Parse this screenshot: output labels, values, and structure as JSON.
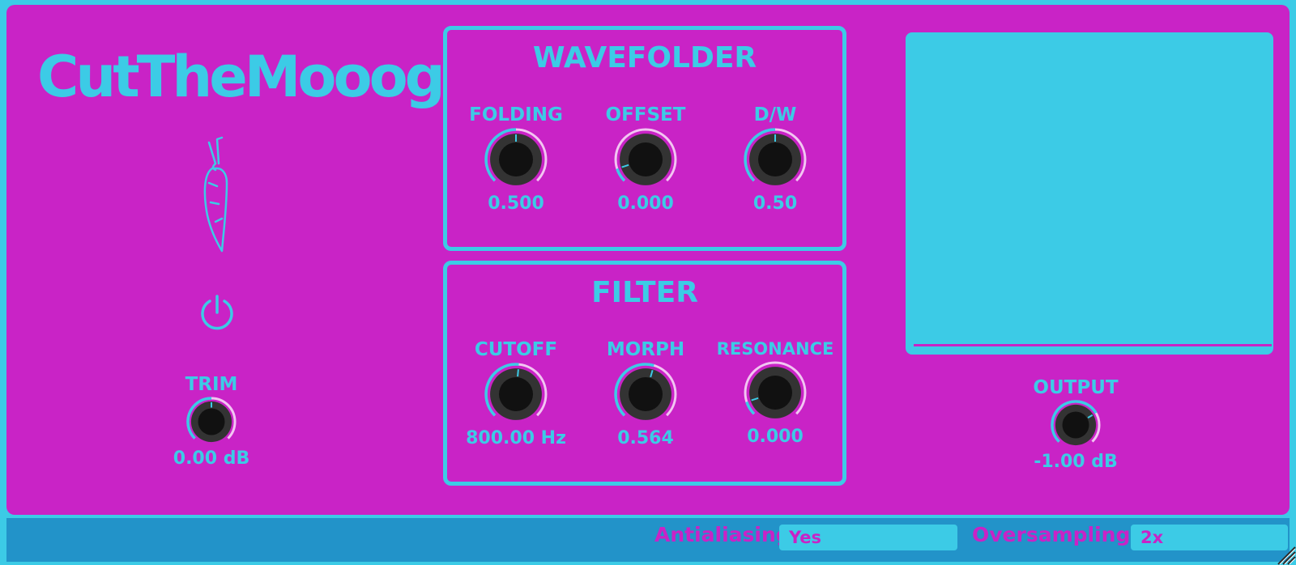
{
  "app": {
    "title": "CutTheMooog"
  },
  "trim": {
    "label": "TRIM",
    "value": "0.00 dB",
    "level": 0.5
  },
  "wavefolder": {
    "title": "WAVEFOLDER",
    "knobs": [
      {
        "label": "FOLDING",
        "value": "0.500",
        "level": 0.5
      },
      {
        "label": "OFFSET",
        "value": "0.000",
        "level": 0.1
      },
      {
        "label": "D/W",
        "value": "0.50",
        "level": 0.5
      }
    ]
  },
  "filter": {
    "title": "FILTER",
    "knobs": [
      {
        "label": "CUTOFF",
        "value": "800.00 Hz",
        "level": 0.52
      },
      {
        "label": "MORPH",
        "value": "0.564",
        "level": 0.56
      },
      {
        "label": "RESONANCE",
        "value": "0.000",
        "level": 0.1
      }
    ]
  },
  "output": {
    "label": "OUTPUT",
    "value": "-1.00 dB",
    "level": 0.72
  },
  "footer": {
    "antialiasing_label": "Antialiasing",
    "antialiasing_value": "Yes",
    "oversampling_label": "Oversampling:",
    "oversampling_value": "2x"
  },
  "icons": {
    "logo": "carrot-icon",
    "power": "power-icon",
    "resize": "resize-grip-icon"
  },
  "colors": {
    "background": "#c923c6",
    "accent": "#3ccbe6",
    "footer": "#2293c9",
    "knob_body": "#111111",
    "knob_ring": "#333333",
    "knob_track": "#f2c6f2"
  }
}
